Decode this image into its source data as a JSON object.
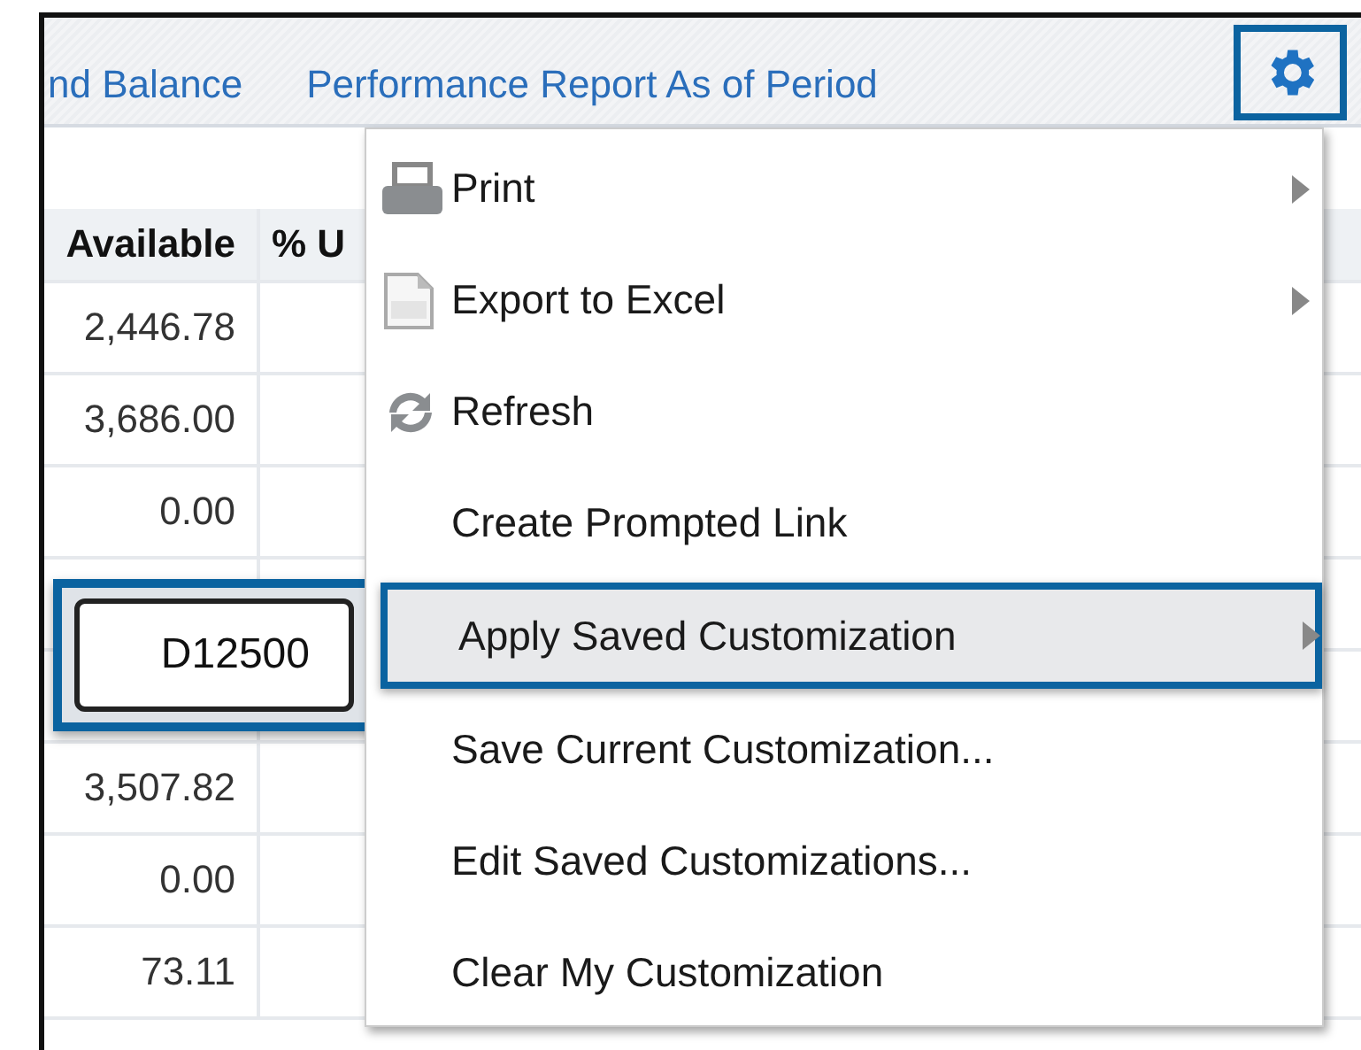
{
  "tabs": [
    {
      "label": "nd Balance",
      "selected": false
    },
    {
      "label": "Performance Report As of Period",
      "selected": false
    }
  ],
  "settings_button": {
    "highlighted": true
  },
  "table": {
    "columns": [
      "Available",
      "% U"
    ],
    "rows": [
      {
        "cells": [
          "2,446.78",
          ""
        ]
      },
      {
        "cells": [
          "3,686.00",
          ""
        ]
      },
      {
        "cells": [
          "0.00",
          ""
        ]
      },
      {
        "cells": [
          "",
          ""
        ]
      },
      {
        "cells": [
          "",
          ""
        ]
      },
      {
        "cells": [
          "3,507.82",
          ""
        ]
      },
      {
        "cells": [
          "0.00",
          ""
        ]
      },
      {
        "cells": [
          "73.11",
          ""
        ]
      }
    ]
  },
  "tooltip": {
    "text": "D12500",
    "highlighted": true
  },
  "menu": {
    "items": [
      {
        "label": "Print",
        "kind": "printer",
        "submenu": true,
        "selected": false
      },
      {
        "label": "Export to Excel",
        "kind": "excel",
        "submenu": true,
        "selected": false
      },
      {
        "label": "Refresh",
        "kind": "refresh",
        "submenu": false,
        "selected": false
      },
      {
        "label": "Create Prompted Link",
        "kind": "plain",
        "submenu": false,
        "selected": false
      },
      {
        "label": "Apply Saved Customization",
        "kind": "plain",
        "submenu": true,
        "selected": true
      },
      {
        "label": "Save Current Customization...",
        "kind": "plain",
        "submenu": false,
        "selected": false
      },
      {
        "label": "Edit Saved Customizations...",
        "kind": "plain",
        "submenu": false,
        "selected": false
      },
      {
        "label": "Clear My Customization",
        "kind": "plain",
        "submenu": false,
        "selected": false
      }
    ]
  }
}
